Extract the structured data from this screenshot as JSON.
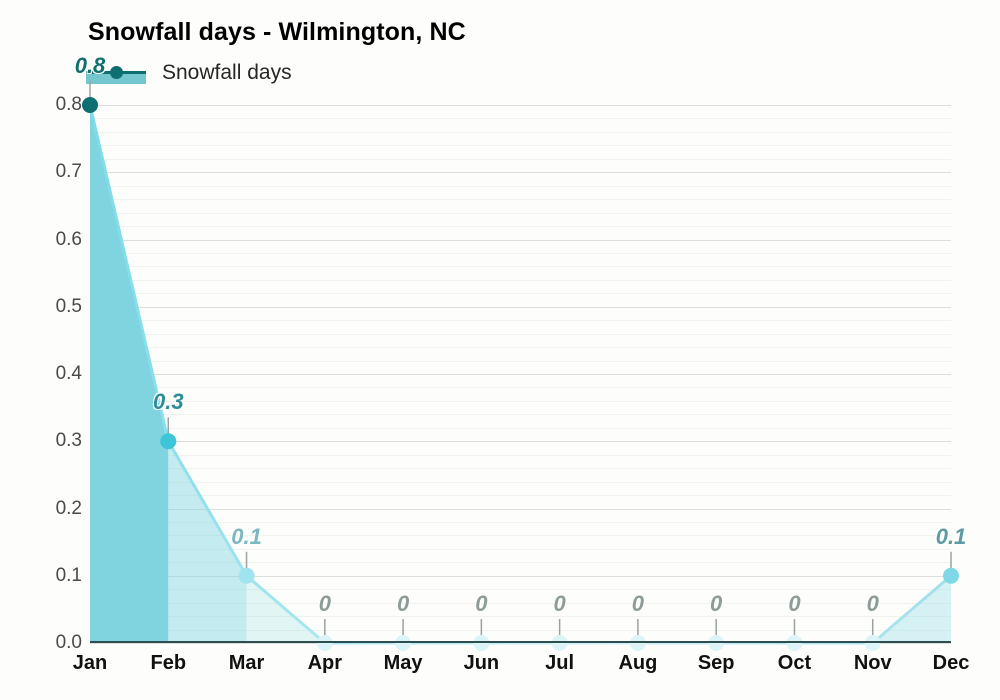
{
  "chart_data": {
    "type": "area",
    "title": "Snowfall days - Wilmington, NC",
    "xlabel": "",
    "ylabel": "",
    "categories": [
      "Jan",
      "Feb",
      "Mar",
      "Apr",
      "May",
      "Jun",
      "Jul",
      "Aug",
      "Sep",
      "Oct",
      "Nov",
      "Dec"
    ],
    "values": [
      0.8,
      0.3,
      0.1,
      0,
      0,
      0,
      0,
      0,
      0,
      0,
      0,
      0.1
    ],
    "point_labels": [
      "0.8",
      "0.3",
      "0.1",
      "0",
      "0",
      "0",
      "0",
      "0",
      "0",
      "0",
      "0",
      "0.1"
    ],
    "series": [
      {
        "name": "Snowfall days",
        "values": [
          0.8,
          0.3,
          0.1,
          0,
          0,
          0,
          0,
          0,
          0,
          0,
          0,
          0.1
        ]
      }
    ],
    "ylim": [
      0.0,
      0.8
    ],
    "yticks": [
      "0.0",
      "0.1",
      "0.2",
      "0.3",
      "0.4",
      "0.5",
      "0.6",
      "0.7",
      "0.8"
    ],
    "ytick_values": [
      0.0,
      0.1,
      0.2,
      0.3,
      0.4,
      0.5,
      0.6,
      0.7,
      0.8
    ],
    "grid": true,
    "minor_grid": true,
    "legend": {
      "position": "top-left",
      "entries": [
        "Snowfall days"
      ]
    },
    "colors": {
      "background": "#fdfefb",
      "line_dark": "#0e6f72",
      "line_light": "#7fdbea",
      "fill_strong": "#7fd4e0",
      "fill_light": "#d8f2f7",
      "axis": "#2e4d4f",
      "grid_major": "#dcdedb",
      "grid_minor": "#f0f2ec",
      "label_dark": "#11706f",
      "label_mid": "#5d9aa2",
      "label_zero": "#8d9b99",
      "tick_text": "#4a4a4a",
      "title_text": "#000000"
    },
    "point_label_colors": [
      "#11706f",
      "#2f8d98",
      "#7bb8c1",
      "#8d9b99",
      "#8d9b99",
      "#8d9b99",
      "#8d9b99",
      "#8d9b99",
      "#8d9b99",
      "#8d9b99",
      "#8d9b99",
      "#5d9aa2"
    ],
    "marker_colors": [
      "#0e6f72",
      "#3cc6d8",
      "#9fe4ee",
      "#dcf4f8",
      "#dcf4f8",
      "#dcf4f8",
      "#dcf4f8",
      "#dcf4f8",
      "#dcf4f8",
      "#dcf4f8",
      "#dcf4f8",
      "#7fd8e6"
    ],
    "segment_fill_opacity": [
      1.0,
      0.45,
      0.22,
      0.12,
      0.12,
      0.12,
      0.12,
      0.12,
      0.12,
      0.12,
      0.3
    ]
  },
  "legend": {
    "label": "Snowfall days"
  },
  "title": {
    "text": "Snowfall days - Wilmington, NC"
  }
}
